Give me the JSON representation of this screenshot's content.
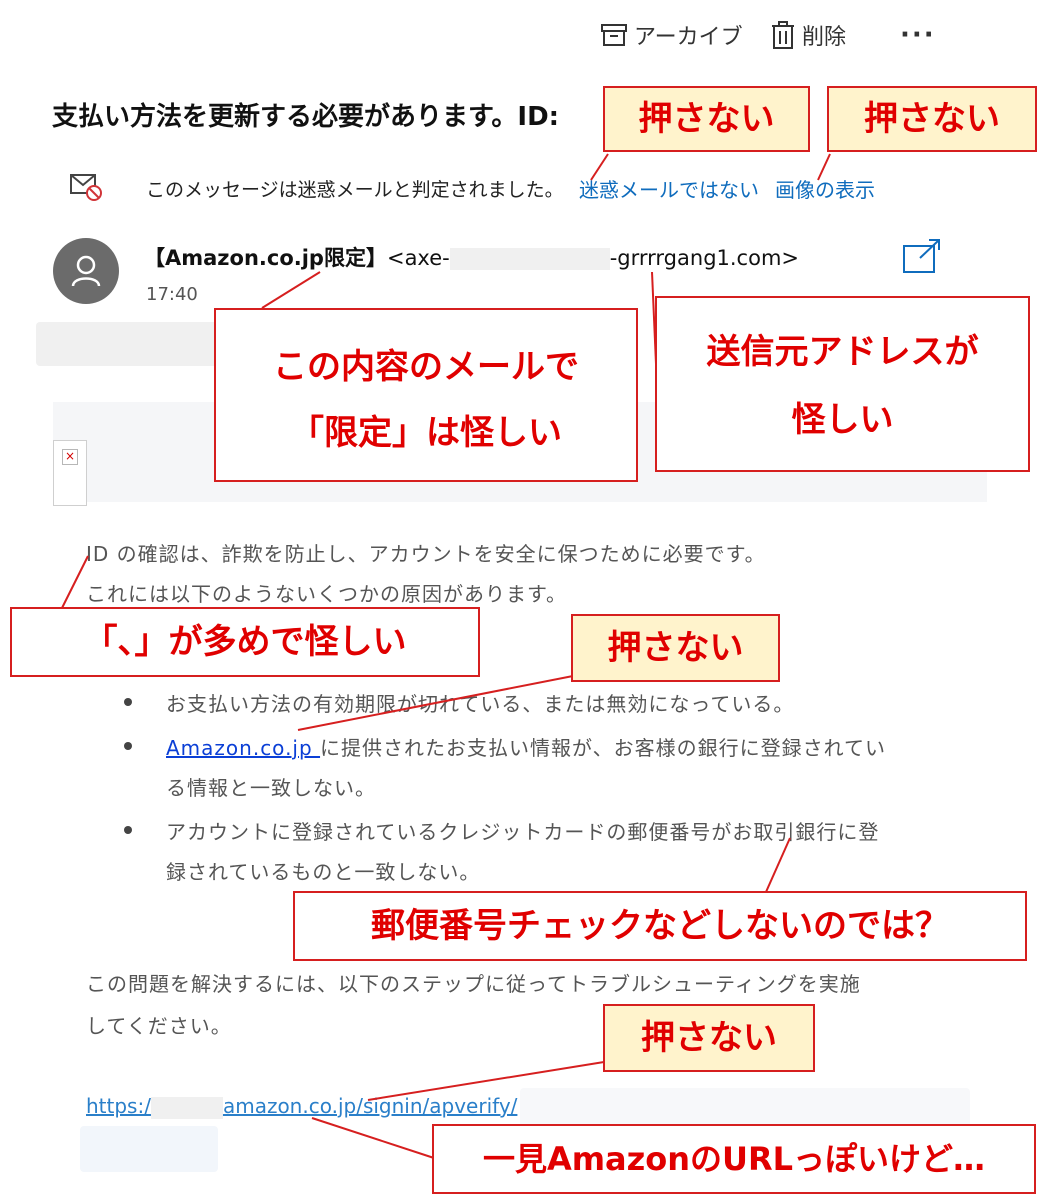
{
  "toolbar": {
    "archive_label": "アーカイブ",
    "delete_label": "削除",
    "more_label": "···"
  },
  "email": {
    "subject": "支払い方法を更新する必要があります。ID:",
    "junk_notice": "このメッセージは迷惑メールと判定されました。",
    "not_junk_link": "迷惑メールではない",
    "show_images_link": "画像の表示",
    "sender_name": "【Amazon.co.jp限定】",
    "sender_addr_prefix": "<axe-",
    "sender_addr_suffix": "-grrrrgang1.com>",
    "time": "17:40",
    "body": {
      "para1_line1": "ID の確認は、詐欺を防止し、アカウントを安全に保つために必要です。",
      "para1_line2": "これには以下のようないくつかの原因があります。",
      "bullets": [
        {
          "line1": "お支払い方法の有効期限が切れている、または無効になっている。"
        },
        {
          "link": "Amazon.co.jp ",
          "line1": "に提供されたお支払い情報が、お客様の銀行に登録されてい",
          "line2": "る情報と一致しない。"
        },
        {
          "line1": "アカウントに登録されているクレジットカードの郵便番号がお取引銀行に登",
          "line2": "録されているものと一致しない。"
        }
      ],
      "para2_line1": "この問題を解決するには、以下のステップに従ってトラブルシューティングを実施",
      "para2_line2": "してください。",
      "url_prefix": "https:/",
      "url_suffix": "amazon.co.jp/signin/apverify/"
    }
  },
  "annotations": {
    "dont_press_1": "押さない",
    "dont_press_2": "押さない",
    "limited_suspicious_line1": "この内容のメールで",
    "limited_suspicious_line2": "「限定」は怪しい",
    "sender_suspicious_line1": "送信元アドレスが",
    "sender_suspicious_line2": "怪しい",
    "commas_suspicious": "「、」が多めで怪しい",
    "dont_press_3": "押さない",
    "postal_check": "郵便番号チェックなどしないのでは？",
    "dont_press_4": "押さない",
    "looks_like_amazon_url": "一見AmazonのURLっぽいけど…"
  },
  "colors": {
    "callout_text": "#e00000",
    "callout_border": "#d61f1f",
    "callout_yellow_bg": "#fff3cc",
    "link_blue": "#0f6cbd"
  }
}
